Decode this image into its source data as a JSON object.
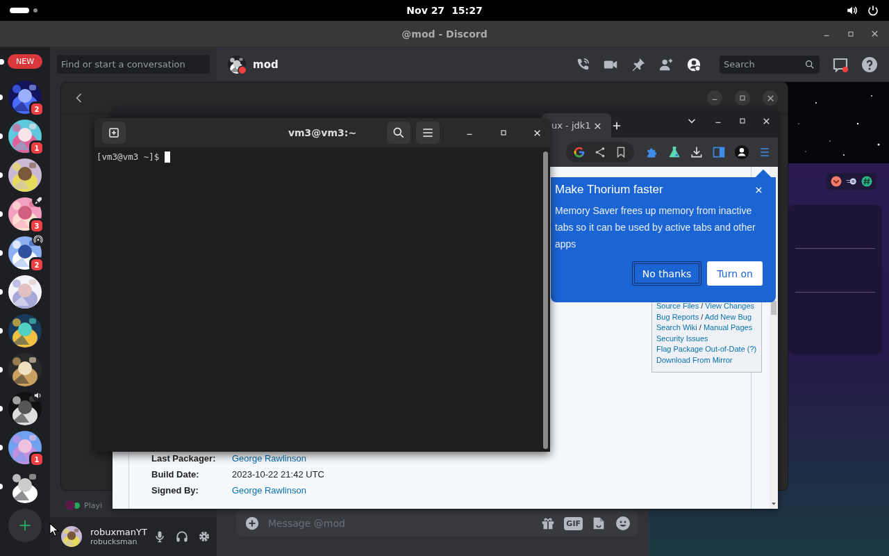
{
  "top_bar": {
    "date": "Nov 27",
    "time": "15:27"
  },
  "discord": {
    "title": "@mod - Discord",
    "new_badge": "NEW",
    "servers": [
      {
        "badge": "2",
        "unread": true
      },
      {
        "badge": "1",
        "unread": true
      },
      {
        "unread": true
      },
      {
        "badge": "3",
        "kind": "rocket",
        "unread": true
      },
      {
        "badge": "2",
        "kind": "broadcast",
        "unread": true
      },
      {
        "unread": true
      },
      {
        "unread": true
      },
      {
        "unread": true
      },
      {
        "kind": "speaker",
        "unread": true
      },
      {
        "badge": "1",
        "unread": true
      },
      {
        "unread": true
      }
    ],
    "dm_search": {
      "placeholder": "Find or start a conversation"
    },
    "dm_peek": "Playi",
    "user": {
      "name": "robuxmanYT",
      "handle": "robucksman"
    },
    "channel": {
      "name": "mod",
      "dnd": true
    },
    "search": {
      "placeholder": "Search"
    },
    "composer": {
      "placeholder": "Message @mod",
      "gif_label": "GIF"
    }
  },
  "browser": {
    "tab_title": "ux - jdk1",
    "popup": {
      "title": "Make Thorium faster",
      "body": "Memory Saver frees up memory from inactive tabs so it can be used by active tabs and other apps",
      "buttons": [
        {
          "label": "No thanks",
          "kind": "outline"
        },
        {
          "label": "Turn on",
          "kind": "filled"
        }
      ]
    },
    "link_separator": "/",
    "sidebar_links": [
      [
        "Source Files",
        "View Changes"
      ],
      [
        "Bug Reports",
        "Add New Bug"
      ],
      [
        "Search Wiki",
        "Manual Pages"
      ],
      [
        "Security Issues"
      ],
      [
        "Flag Package Out-of-Date (?)"
      ],
      [
        "Download From Mirror"
      ]
    ],
    "details": [
      {
        "label": "Last Packager:",
        "value": "George Rawlinson",
        "kind": "link"
      },
      {
        "label": "Build Date:",
        "value": "2023-10-22 21:42 UTC",
        "kind": "text"
      },
      {
        "label": "Signed By:",
        "value": "George Rawlinson",
        "kind": "link"
      }
    ]
  },
  "terminal": {
    "title": "vm3@vm3:~",
    "prompt": "[vm3@vm3 ~]$"
  }
}
